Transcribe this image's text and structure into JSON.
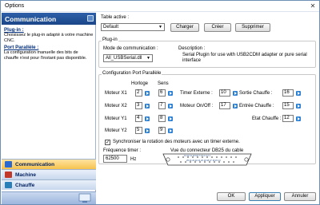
{
  "window": {
    "title": "Options",
    "close_glyph": "✕"
  },
  "sidebar": {
    "header": "Communication",
    "sections": [
      {
        "title": "Plug-in :",
        "text": "Choisissez le plug-in adapté à votre machine CNC."
      },
      {
        "title": "Port Parallèle :",
        "text": "La configuration manuelle des bits de chauffe n'est pour l'instant pas disponible."
      }
    ],
    "nav": [
      {
        "label": "Communication",
        "icon": "communication-icon",
        "active": true,
        "color": "#2a6ad0"
      },
      {
        "label": "Machine",
        "icon": "machine-icon",
        "active": false,
        "color": "#c0392b"
      },
      {
        "label": "Chauffe",
        "icon": "chauffe-icon",
        "active": false,
        "color": "#2980b9"
      }
    ]
  },
  "table": {
    "label": "Table active :",
    "value": "Default",
    "buttons": {
      "load": "Charger",
      "create": "Créer",
      "delete": "Supprimer"
    }
  },
  "plugin": {
    "group_label": "Plug-in",
    "mode_label": "Mode de communication :",
    "mode_value": "All_USBSerial.dll",
    "desc_label": "Description :",
    "desc_text": "Serial Plugin for use with USB2CDM adapter or pure serial interface"
  },
  "parallel": {
    "group_label": "Configuration Port Parallèle",
    "col_horloge": "Horloge",
    "col_sens": "Sens",
    "motors": [
      {
        "label": "Moteur X1",
        "horloge": "2",
        "sens": "6"
      },
      {
        "label": "Moteur X2",
        "horloge": "3",
        "sens": "7"
      },
      {
        "label": "Moteur Y1",
        "horloge": "4",
        "sens": "8"
      },
      {
        "label": "Moteur Y2",
        "horloge": "5",
        "sens": "9"
      }
    ],
    "mid": [
      {
        "label": "Timer Externe :",
        "value": "10"
      },
      {
        "label": "Moteur On/Off :",
        "value": "17"
      }
    ],
    "right": [
      {
        "label": "Sortie Chauffe :",
        "value": "16"
      },
      {
        "label": "Entrée Chauffe :",
        "value": "15"
      },
      {
        "label": "Etat Chauffe :",
        "value": "12"
      }
    ],
    "sync_checked": true,
    "sync_label": "Synchroniser la rotation des moteurs avec un timer externe.",
    "freq_label": "Fréquence timer :",
    "freq_value": "62500",
    "freq_unit": "Hz",
    "connector_label": "Vue du connecteur DB25 du cable",
    "connector_digits_top": "13 12 11 10 9 8 7 6 5 4 3 2 1",
    "connector_digits_bottom": "25 24 23 22 21 20 19 18 17 16 15 14"
  },
  "footer": {
    "ok": "OK",
    "apply": "Appliquer",
    "cancel": "Annuler"
  },
  "colors": {
    "accent": "#1b4688",
    "spin": "#2a80d6"
  }
}
